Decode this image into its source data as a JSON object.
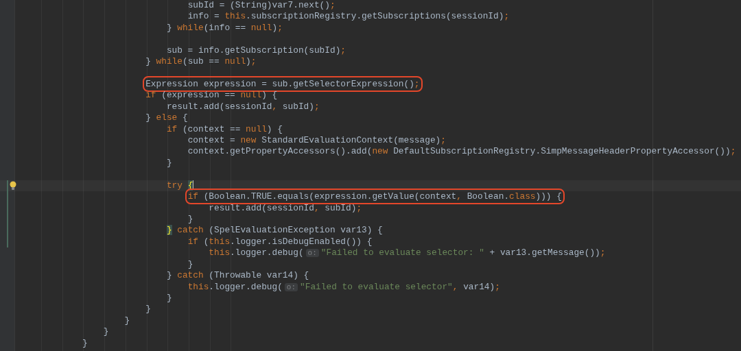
{
  "editor": {
    "lines": [
      {
        "tokens": [
          {
            "kind": "plain",
            "text": "                            subId = (String)var7.next()"
          },
          {
            "kind": "punct",
            "text": ";"
          }
        ]
      },
      {
        "tokens": [
          {
            "kind": "plain",
            "text": "                            info = "
          },
          {
            "kind": "keyword",
            "text": "this"
          },
          {
            "kind": "plain",
            "text": ".subscriptionRegistry.getSubscriptions(sessionId)"
          },
          {
            "kind": "punct",
            "text": ";"
          }
        ]
      },
      {
        "tokens": [
          {
            "kind": "plain",
            "text": "                        } "
          },
          {
            "kind": "keyword",
            "text": "while"
          },
          {
            "kind": "plain",
            "text": "(info == "
          },
          {
            "kind": "keyword",
            "text": "null"
          },
          {
            "kind": "plain",
            "text": ")"
          },
          {
            "kind": "punct",
            "text": ";"
          }
        ]
      },
      {
        "blank": true
      },
      {
        "tokens": [
          {
            "kind": "plain",
            "text": "                        sub = info.getSubscription(subId)"
          },
          {
            "kind": "punct",
            "text": ";"
          }
        ]
      },
      {
        "tokens": [
          {
            "kind": "plain",
            "text": "                    } "
          },
          {
            "kind": "keyword",
            "text": "while"
          },
          {
            "kind": "plain",
            "text": "(sub == "
          },
          {
            "kind": "keyword",
            "text": "null"
          },
          {
            "kind": "plain",
            "text": ")"
          },
          {
            "kind": "punct",
            "text": ";"
          }
        ]
      },
      {
        "blank": true
      },
      {
        "boxed": true,
        "tokens": [
          {
            "kind": "plain",
            "text": "                    Expression expression = sub.getSelectorExpression()"
          },
          {
            "kind": "punct",
            "text": ";"
          }
        ]
      },
      {
        "tokens": [
          {
            "kind": "keyword",
            "text": "                    if"
          },
          {
            "kind": "plain",
            "text": " (expression == "
          },
          {
            "kind": "keyword",
            "text": "null"
          },
          {
            "kind": "plain",
            "text": ") {"
          }
        ]
      },
      {
        "tokens": [
          {
            "kind": "plain",
            "text": "                        result.add(sessionId"
          },
          {
            "kind": "punct",
            "text": ","
          },
          {
            "kind": "plain",
            "text": " subId)"
          },
          {
            "kind": "punct",
            "text": ";"
          }
        ]
      },
      {
        "tokens": [
          {
            "kind": "plain",
            "text": "                    } "
          },
          {
            "kind": "keyword",
            "text": "else"
          },
          {
            "kind": "plain",
            "text": " {"
          }
        ]
      },
      {
        "tokens": [
          {
            "kind": "keyword",
            "text": "                        if"
          },
          {
            "kind": "plain",
            "text": " (context == "
          },
          {
            "kind": "keyword",
            "text": "null"
          },
          {
            "kind": "plain",
            "text": ") {"
          }
        ]
      },
      {
        "tokens": [
          {
            "kind": "plain",
            "text": "                            context = "
          },
          {
            "kind": "keyword",
            "text": "new"
          },
          {
            "kind": "plain",
            "text": " StandardEvaluationContext(message)"
          },
          {
            "kind": "punct",
            "text": ";"
          }
        ]
      },
      {
        "tokens": [
          {
            "kind": "plain",
            "text": "                            context.getPropertyAccessors().add("
          },
          {
            "kind": "keyword",
            "text": "new"
          },
          {
            "kind": "plain",
            "text": " DefaultSubscriptionRegistry.SimpMessageHeaderPropertyAccessor())"
          },
          {
            "kind": "punct",
            "text": ";"
          }
        ]
      },
      {
        "tokens": [
          {
            "kind": "plain",
            "text": "                        }"
          }
        ]
      },
      {
        "blank": true
      },
      {
        "current": true,
        "changed": true,
        "bulb": true,
        "tokens": [
          {
            "kind": "keyword",
            "text": "                        try "
          },
          {
            "kind": "brace",
            "text": "{"
          }
        ]
      },
      {
        "changed": true,
        "boxed": true,
        "tokens": [
          {
            "kind": "keyword",
            "text": "                            if"
          },
          {
            "kind": "plain",
            "text": " (Boolean.TRUE.equals(expression.getValue(context"
          },
          {
            "kind": "punct",
            "text": ","
          },
          {
            "kind": "plain",
            "text": " Boolean."
          },
          {
            "kind": "keyword",
            "text": "class"
          },
          {
            "kind": "plain",
            "text": "))) {"
          }
        ]
      },
      {
        "changed": true,
        "tokens": [
          {
            "kind": "plain",
            "text": "                                result.add(sessionId"
          },
          {
            "kind": "punct",
            "text": ","
          },
          {
            "kind": "plain",
            "text": " subId)"
          },
          {
            "kind": "punct",
            "text": ";"
          }
        ]
      },
      {
        "changed": true,
        "tokens": [
          {
            "kind": "plain",
            "text": "                            }"
          }
        ]
      },
      {
        "changed": true,
        "tokens": [
          {
            "kind": "brace",
            "text": "                        }"
          },
          {
            "kind": "keyword",
            "text": " catch"
          },
          {
            "kind": "plain",
            "text": " (SpelEvaluationException var13) {"
          }
        ]
      },
      {
        "changed": true,
        "tokens": [
          {
            "kind": "keyword",
            "text": "                            if"
          },
          {
            "kind": "plain",
            "text": " ("
          },
          {
            "kind": "keyword",
            "text": "this"
          },
          {
            "kind": "plain",
            "text": ".logger.isDebugEnabled()) {"
          }
        ]
      },
      {
        "tokens": [
          {
            "kind": "keyword",
            "text": "                                this"
          },
          {
            "kind": "plain",
            "text": ".logger.debug("
          },
          {
            "kind": "hint",
            "text": "o:"
          },
          {
            "kind": "string",
            "text": "\"Failed to evaluate selector: \""
          },
          {
            "kind": "plain",
            "text": " + var13.getMessage())"
          },
          {
            "kind": "punct",
            "text": ";"
          }
        ]
      },
      {
        "tokens": [
          {
            "kind": "plain",
            "text": "                            }"
          }
        ]
      },
      {
        "tokens": [
          {
            "kind": "plain",
            "text": "                        } "
          },
          {
            "kind": "keyword",
            "text": "catch"
          },
          {
            "kind": "plain",
            "text": " (Throwable var14) {"
          }
        ]
      },
      {
        "tokens": [
          {
            "kind": "keyword",
            "text": "                            this"
          },
          {
            "kind": "plain",
            "text": ".logger.debug("
          },
          {
            "kind": "hint",
            "text": "o:"
          },
          {
            "kind": "string",
            "text": "\"Failed to evaluate selector\""
          },
          {
            "kind": "punct",
            "text": ","
          },
          {
            "kind": "plain",
            "text": " var14)"
          },
          {
            "kind": "punct",
            "text": ";"
          }
        ]
      },
      {
        "tokens": [
          {
            "kind": "plain",
            "text": "                        }"
          }
        ]
      },
      {
        "tokens": [
          {
            "kind": "plain",
            "text": "                    }"
          }
        ]
      },
      {
        "tokens": [
          {
            "kind": "plain",
            "text": "                }"
          }
        ]
      },
      {
        "tokens": [
          {
            "kind": "plain",
            "text": "            }"
          }
        ]
      },
      {
        "tokens": [
          {
            "kind": "plain",
            "text": "        }"
          }
        ]
      }
    ]
  }
}
